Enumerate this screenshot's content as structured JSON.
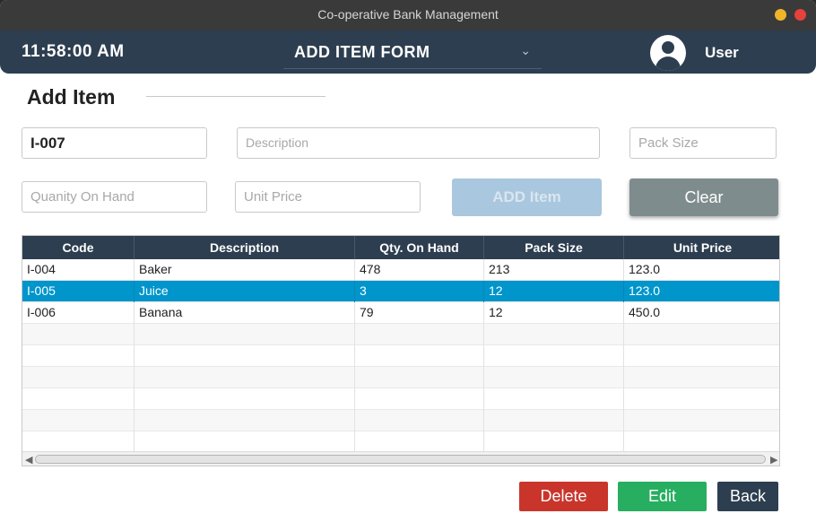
{
  "window": {
    "title": "Co-operative Bank Management"
  },
  "header": {
    "time": "11:58:00 AM",
    "form_selector": "ADD ITEM FORM",
    "user": "User"
  },
  "page": {
    "title": "Add Item"
  },
  "form": {
    "code_value": "I-007",
    "description_placeholder": "Description",
    "pack_size_placeholder": "Pack Size",
    "qty_placeholder": "Quanity On Hand",
    "unit_price_placeholder": "Unit Price",
    "add_label": "ADD Item",
    "clear_label": "Clear"
  },
  "table": {
    "columns": [
      "Code",
      "Description",
      "Qty. On Hand",
      "Pack Size",
      "Unit Price"
    ],
    "rows": [
      [
        "I-004",
        "Baker",
        "478",
        "213",
        "123.0"
      ],
      [
        "I-005",
        "Juice",
        "3",
        "12",
        "123.0"
      ],
      [
        "I-006",
        "Banana",
        "79",
        "12",
        "450.0"
      ]
    ],
    "selected_row": 1
  },
  "actions": {
    "delete_label": "Delete",
    "edit_label": "Edit",
    "back_label": "Back"
  },
  "colors": {
    "header": "#2d3e50",
    "selected_row": "#0095cb",
    "delete": "#c9352b",
    "edit": "#27ae60",
    "clear": "#7f8c8d",
    "add_disabled": "#a9c7de"
  }
}
